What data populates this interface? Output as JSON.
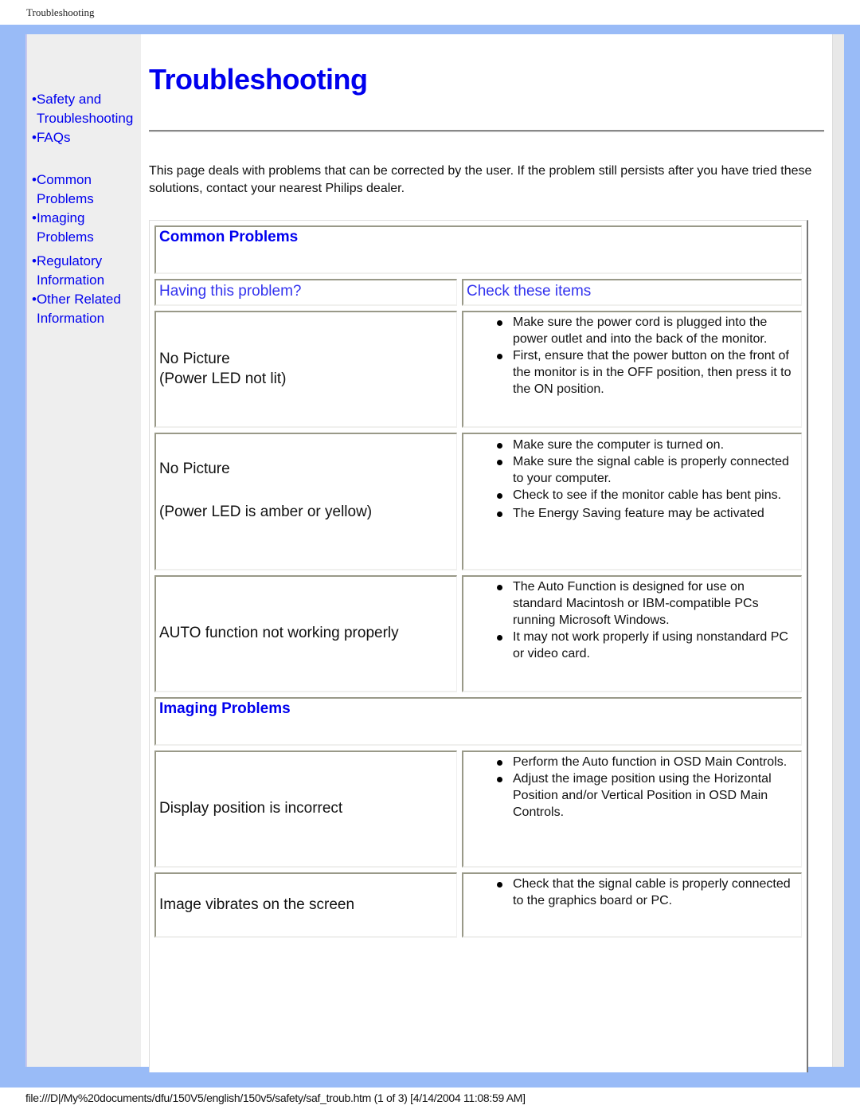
{
  "print_header": {
    "title": "Troubleshooting"
  },
  "sidebar": {
    "group1": [
      {
        "line1": "•Safety and",
        "line2": "Troubleshooting"
      },
      {
        "line1": "•FAQs",
        "line2": ""
      }
    ],
    "group2": [
      {
        "line1": "•Common",
        "line2": "Problems"
      },
      {
        "line1": "•Imaging",
        "line2": "Problems"
      }
    ],
    "group3": [
      {
        "line1": "•Regulatory",
        "line2": "Information"
      },
      {
        "line1": "•Other Related",
        "line2": "Information"
      }
    ]
  },
  "main": {
    "title": "Troubleshooting",
    "intro": "This page deals with problems that can be corrected by the user. If the problem still persists after you have tried these solutions, contact your nearest Philips dealer.",
    "common": {
      "heading": "Common Problems",
      "col_problem": "Having this problem?",
      "col_check": "Check these items",
      "rows": [
        {
          "problem": [
            "No Picture",
            "(Power LED not lit)"
          ],
          "checks": [
            "Make sure the power cord is plugged into the power outlet and into the back of the monitor.",
            "First, ensure that the power button on the front of the monitor is in the OFF position, then press it to the ON position."
          ]
        },
        {
          "problem": [
            "No Picture",
            "(Power LED is amber or yellow)"
          ],
          "checks": [
            "Make sure the computer is turned on.",
            "Make sure the signal cable is properly connected to your computer.",
            "Check to see if the monitor cable has bent pins.",
            "The Energy Saving feature may be activated"
          ]
        },
        {
          "problem": [
            "AUTO function not working properly"
          ],
          "checks": [
            "The Auto Function is designed for use on standard Macintosh or IBM-compatible PCs running Microsoft Windows.",
            "It may not work properly if using nonstandard PC or video card."
          ]
        }
      ]
    },
    "imaging": {
      "heading": "Imaging Problems",
      "rows": [
        {
          "problem": [
            "Display position is incorrect"
          ],
          "checks": [
            "Perform the Auto function in OSD Main Controls.",
            "Adjust the image position using the Horizontal Position and/or Vertical Position in OSD Main Controls."
          ]
        },
        {
          "problem": [
            "Image vibrates on the screen"
          ],
          "checks": [
            "Check that the signal cable is properly connected to the graphics board or PC."
          ]
        }
      ]
    }
  },
  "footer": {
    "text": "file:///D|/My%20documents/dfu/150V5/english/150v5/safety/saf_troub.htm (1 of 3) [4/14/2004 11:08:59 AM]"
  }
}
